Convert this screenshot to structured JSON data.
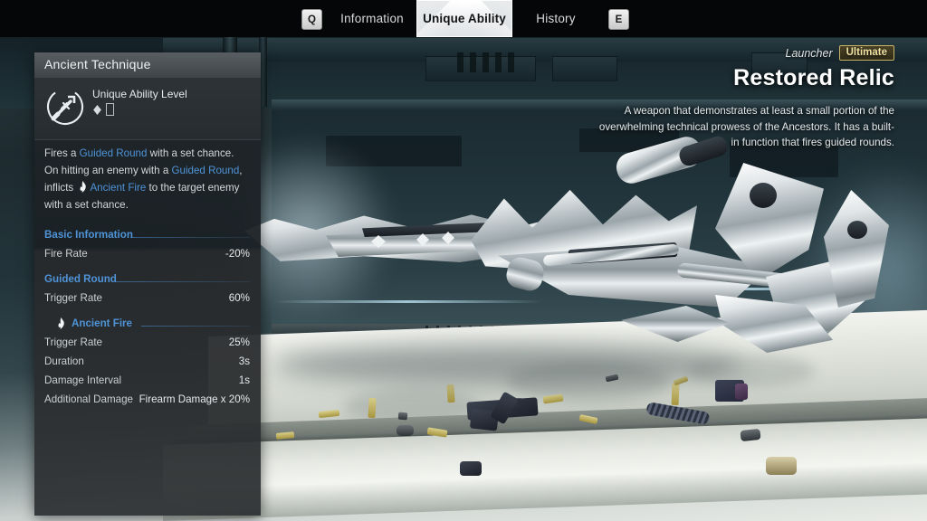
{
  "nav": {
    "prev_key": "Q",
    "next_key": "E",
    "tabs": [
      {
        "label": "Information",
        "active": false
      },
      {
        "label": "Unique Ability",
        "active": true
      },
      {
        "label": "History",
        "active": false
      }
    ]
  },
  "panel": {
    "title": "Ancient Technique",
    "ability_icon": "rocket-arrow-icon",
    "level_label": "Unique Ability Level",
    "level_value": "◈ ▯",
    "description": {
      "segments": [
        {
          "text": "Fires a ",
          "style": "normal"
        },
        {
          "text": "Guided Round",
          "style": "highlight"
        },
        {
          "text": " with a set chance.",
          "style": "normal"
        },
        {
          "text": "\n",
          "style": "break"
        },
        {
          "text": "On hitting an enemy with a ",
          "style": "normal"
        },
        {
          "text": "Guided Round",
          "style": "highlight"
        },
        {
          "text": ",",
          "style": "normal"
        },
        {
          "text": "\n",
          "style": "break"
        },
        {
          "text": "inflicts ",
          "style": "normal"
        },
        {
          "text": "flame-icon",
          "style": "icon"
        },
        {
          "text": "Ancient Fire",
          "style": "highlight"
        },
        {
          "text": " to the target enemy",
          "style": "normal"
        },
        {
          "text": "\n",
          "style": "break"
        },
        {
          "text": "with a set chance.",
          "style": "normal"
        }
      ]
    },
    "sections": [
      {
        "heading": "Basic Information",
        "icon": null,
        "rows": [
          {
            "key": "Fire Rate",
            "value": "-20%"
          }
        ]
      },
      {
        "heading": "Guided Round",
        "icon": null,
        "rows": [
          {
            "key": "Trigger Rate",
            "value": "60%"
          }
        ]
      },
      {
        "heading": "Ancient Fire",
        "icon": "flame-icon",
        "rows": [
          {
            "key": "Trigger Rate",
            "value": "25%"
          },
          {
            "key": "Duration",
            "value": "3s"
          },
          {
            "key": "Damage Interval",
            "value": "1s"
          },
          {
            "key": "Additional Damage",
            "value": "Firearm Damage x 20%"
          }
        ]
      }
    ]
  },
  "weapon": {
    "type": "Launcher",
    "rarity_badge": "Ultimate",
    "name": "Restored Relic",
    "description": "A weapon that demonstrates at least a small portion of the overwhelming technical prowess of the Ancestors. It has a built-in function that fires guided rounds."
  },
  "colors": {
    "accent_blue": "#4f93d8",
    "badge_gold": "#c8b36a",
    "badge_text": "#f0e2a2",
    "panel_bg": "#1e2428",
    "text_primary": "#e6eaec",
    "text_secondary": "#ccd1d3",
    "topbar_bg": "#050607",
    "active_tab_bg": "#ffffff"
  }
}
